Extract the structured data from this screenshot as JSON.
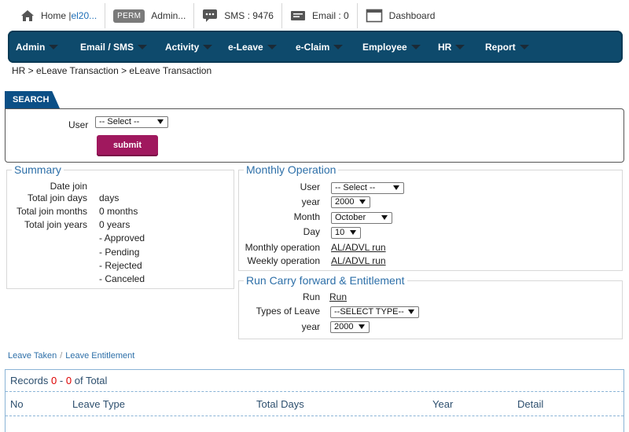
{
  "topbar": {
    "home_label": "Home | ",
    "home_link": "el20...",
    "perm_badge": "PERM",
    "admin_label": "Admin...",
    "sms_label": "SMS : 9476",
    "email_label": "Email : 0",
    "dashboard_label": "Dashboard"
  },
  "nav": [
    "Admin",
    "Email / SMS",
    "Activity",
    "e-Leave",
    "e-Claim",
    "Employee",
    "HR",
    "Report"
  ],
  "breadcrumb": "HR > eLeave Transaction > eLeave Transaction",
  "search": {
    "tab": "SEARCH",
    "user_label": "User",
    "user_value": "-- Select --",
    "submit": "submit"
  },
  "summary": {
    "title": "Summary",
    "date_join_label": "Date join",
    "total_days_label": "Total join days",
    "total_days_value": "days",
    "total_months_label": "Total join months",
    "total_months_value": "0 months",
    "total_years_label": "Total join years",
    "total_years_value": "0 years",
    "statuses": [
      "-  Approved",
      "-  Pending",
      "-  Rejected",
      "-  Canceled"
    ]
  },
  "monthly": {
    "title": "Monthly Operation",
    "user_label": "User",
    "user_value": "-- Select --",
    "year_label": "year",
    "year_value": "2000",
    "month_label": "Month",
    "month_value": "October",
    "day_label": "Day",
    "day_value": "10",
    "monthly_op_label": "Monthly operation",
    "monthly_op_link": "AL/ADVL run",
    "weekly_op_label": "Weekly operation",
    "weekly_op_link": "AL/ADVL run"
  },
  "carry": {
    "title": "Run Carry forward & Entitlement",
    "run_label": "Run",
    "run_link": "Run",
    "types_label": "Types of Leave",
    "types_value": "--SELECT TYPE--",
    "year_label": "year",
    "year_value": "2000"
  },
  "tabs": {
    "leave_taken": "Leave Taken",
    "separator": "/",
    "leave_entitlement": "Leave Entitlement"
  },
  "records": {
    "prefix": "Records",
    "from": "0",
    "dash": "-",
    "to": "0",
    "suffix": "of Total",
    "columns": [
      "No",
      "Leave Type",
      "Total Days",
      "Year",
      "Detail"
    ]
  }
}
